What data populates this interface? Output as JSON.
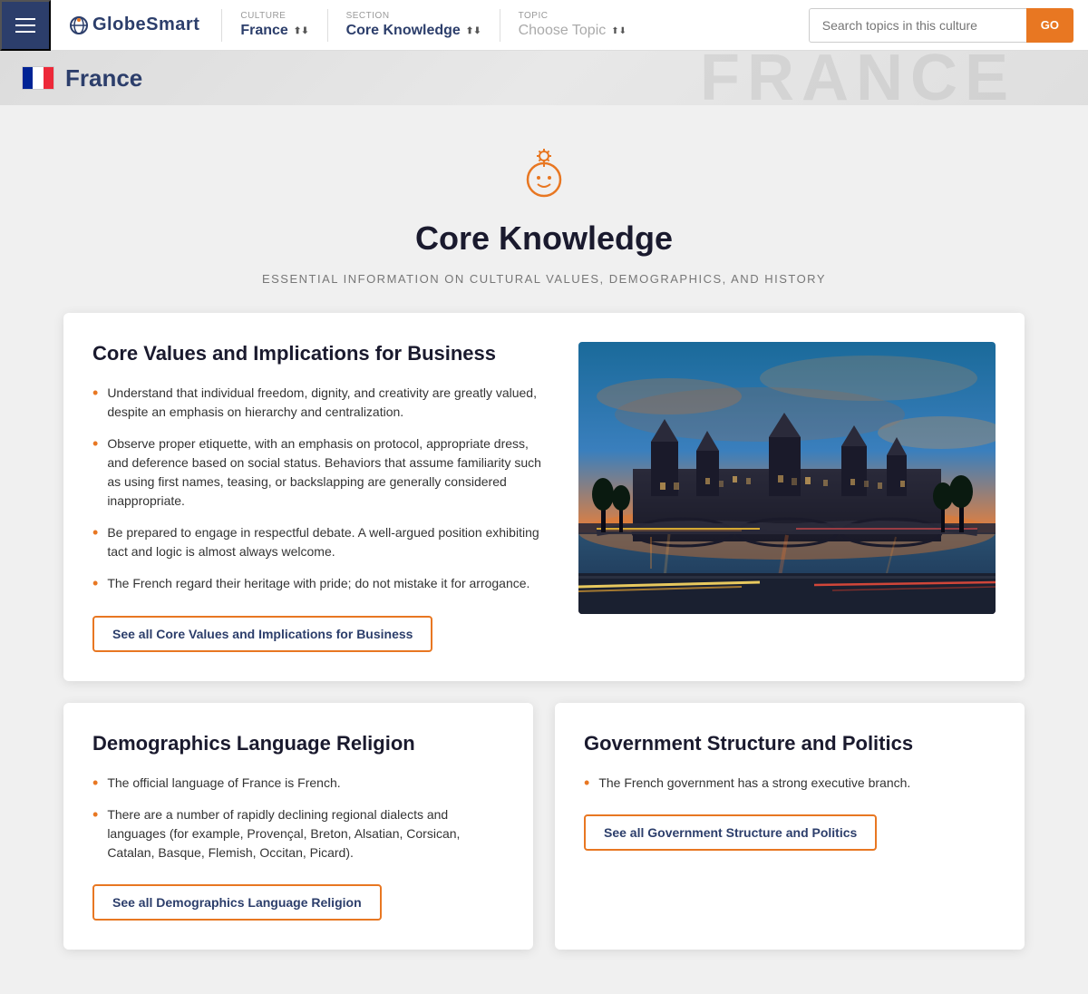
{
  "nav": {
    "hamburger_label": "Menu",
    "logo": "GlobeSmart",
    "culture_label": "CULTURE",
    "culture_value": "France",
    "section_label": "SECTION",
    "section_value": "Core Knowledge",
    "topic_label": "TOPIC",
    "topic_value": "Choose Topic",
    "search_placeholder": "Search topics in this culture",
    "search_btn": "GO"
  },
  "header": {
    "country": "France",
    "watermark": "FRANCE"
  },
  "hero": {
    "title": "Core Knowledge",
    "subtitle": "ESSENTIAL INFORMATION ON CULTURAL VALUES, DEMOGRAPHICS, AND HISTORY"
  },
  "core_values_card": {
    "title": "Core Values and Implications for Business",
    "bullets": [
      "Understand that individual freedom, dignity, and creativity are greatly valued, despite an emphasis on hierarchy and centralization.",
      "Observe proper etiquette, with an emphasis on protocol, appropriate dress, and deference based on social status. Behaviors that assume familiarity such as using first names, teasing, or backslapping are generally considered inappropriate.",
      "Be prepared to engage in respectful debate. A well-argued position exhibiting tact and logic is almost always welcome.",
      "The French regard their heritage with pride; do not mistake it for arrogance."
    ],
    "see_all_btn": "See all Core Values and Implications for Business"
  },
  "demographics_card": {
    "title": "Demographics Language Religion",
    "bullets": [
      "The official language of France is French.",
      "There are a number of rapidly declining regional dialects and languages (for example, Provençal, Breton, Alsatian, Corsican, Catalan, Basque, Flemish, Occitan, Picard)."
    ],
    "see_all_btn": "See all Demographics Language Religion"
  },
  "government_card": {
    "title": "Government Structure and Politics",
    "bullets": [
      "The French government has a strong executive branch."
    ],
    "see_all_btn": "See all Government Structure and Politics"
  }
}
